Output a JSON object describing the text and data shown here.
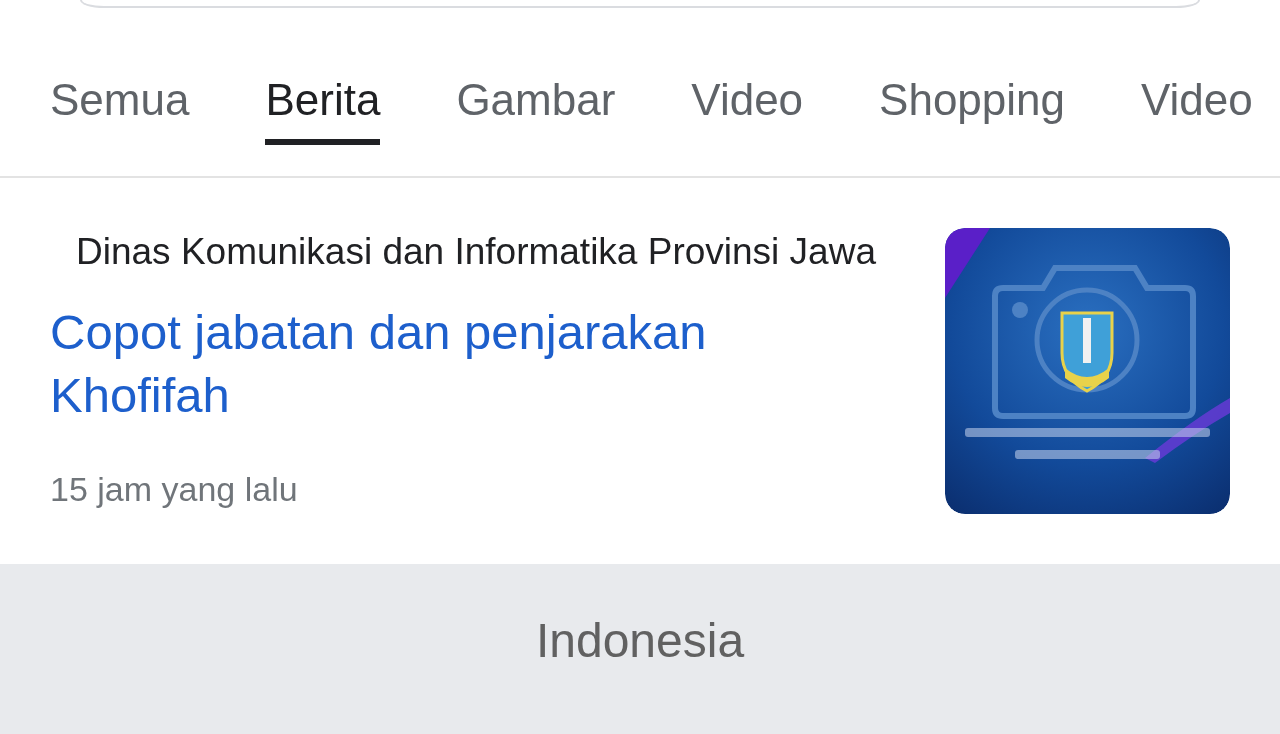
{
  "tabs": [
    {
      "label": "Semua",
      "selected": false
    },
    {
      "label": "Berita",
      "selected": true
    },
    {
      "label": "Gambar",
      "selected": false
    },
    {
      "label": "Video",
      "selected": false
    },
    {
      "label": "Shopping",
      "selected": false
    },
    {
      "label": "Video",
      "selected": false
    }
  ],
  "news_results": [
    {
      "source": "Dinas Komunikasi dan Informatika Provinsi Jawa",
      "title": "Copot jabatan dan penjarakan Khofifah",
      "time": "15 jam yang lalu"
    }
  ],
  "footer": {
    "location": "Indonesia"
  }
}
